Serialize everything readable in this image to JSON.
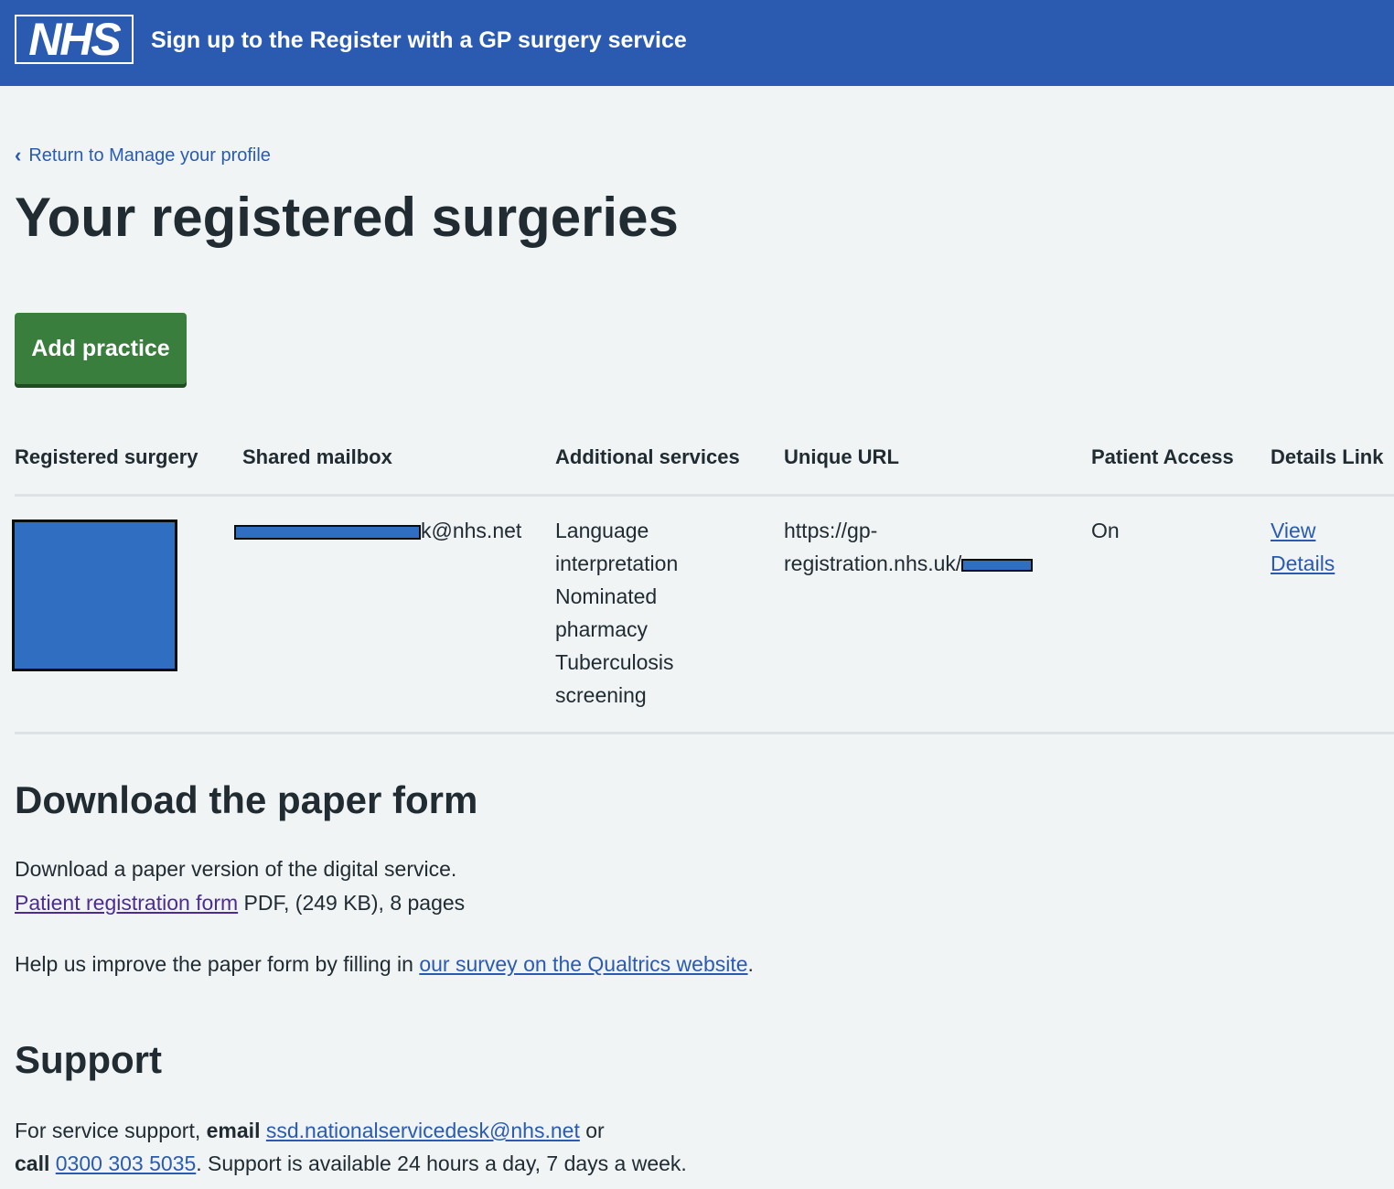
{
  "header": {
    "logo_text": "NHS",
    "service_name": "Sign up to the Register with a GP surgery service"
  },
  "back_link": "Return to Manage your profile",
  "page_title": "Your registered surgeries",
  "add_button": "Add practice",
  "table": {
    "headers": [
      "Registered surgery",
      "Shared mailbox",
      "Additional services",
      "Unique URL",
      "Patient Access",
      "Details Link"
    ],
    "row": {
      "mailbox_suffix": "k@nhs.net",
      "services": [
        "Language",
        "interpretation",
        "Nominated",
        "pharmacy",
        "Tuberculosis",
        "screening"
      ],
      "url_line1": "https://gp-",
      "url_line2": "registration.nhs.uk/",
      "patient_access": "On",
      "details_line1": "View",
      "details_line2": "Details"
    }
  },
  "download": {
    "heading": "Download the paper form",
    "intro": "Download a paper version of the digital service.",
    "form_link": "Patient registration form",
    "form_meta": " PDF, (249 KB), 8 pages",
    "survey_prefix": "Help us improve the paper form by filling in ",
    "survey_link": "our survey on the Qualtrics website",
    "survey_suffix": "."
  },
  "support": {
    "heading": "Support",
    "line1_prefix": "For service support, ",
    "line1_bold": "email",
    "email": "ssd.nationalservicedesk@nhs.net",
    "line1_suffix": " or",
    "line2_bold": "call",
    "phone": "0300 303 5035",
    "line2_suffix": ". Support is available 24 hours a day, 7 days a week."
  }
}
